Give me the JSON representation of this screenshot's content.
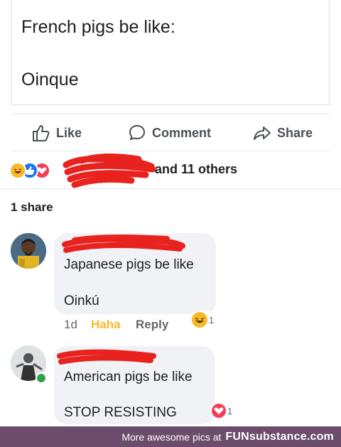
{
  "post": {
    "line1": "French pigs be like:",
    "line2": "Oinque"
  },
  "actions": {
    "like": "Like",
    "comment": "Comment",
    "share": "Share"
  },
  "reactions": {
    "others_text": "and 11 others",
    "share_count": "1 share"
  },
  "comments": [
    {
      "line1": "Japanese pigs be like",
      "line2": "Oinkú",
      "time": "1d",
      "reaction_label": "Haha",
      "reply_label": "Reply",
      "reaction_count": "1"
    },
    {
      "line1": "American pigs be like",
      "line2": "STOP RESISTING",
      "reaction_count": "1"
    }
  ],
  "footer": {
    "text": "More awesome pics at",
    "brand": "FUNsubstance.com"
  },
  "colors": {
    "haha": "#f7b928",
    "like_blue": "#1877f2",
    "love_red": "#f33e58",
    "scribble": "#e8231f",
    "footer_bg": "#6b4c6a"
  }
}
